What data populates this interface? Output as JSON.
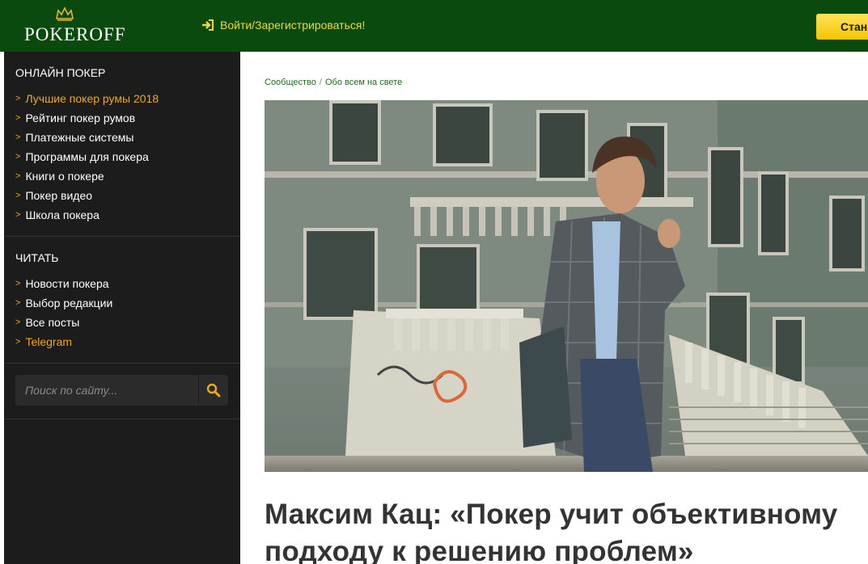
{
  "header": {
    "logo_text": "POKEROFF",
    "login_label": "Войти/Зарегистрироваться!",
    "start_button_label": "Стан",
    "colors": {
      "background": "#0b4a0f",
      "login_text": "#e8d84a",
      "button": "#f5c400"
    }
  },
  "sidebar": {
    "sections": [
      {
        "title": "ОНЛАЙН ПОКЕР",
        "items": [
          {
            "label": "Лучшие покер румы 2018",
            "highlight": true
          },
          {
            "label": "Рейтинг покер румов",
            "highlight": false
          },
          {
            "label": "Платежные системы",
            "highlight": false
          },
          {
            "label": "Программы для покера",
            "highlight": false
          },
          {
            "label": "Книги о покере",
            "highlight": false
          },
          {
            "label": "Покер видео",
            "highlight": false
          },
          {
            "label": "Школа покера",
            "highlight": false
          }
        ]
      },
      {
        "title": "ЧИТАТЬ",
        "items": [
          {
            "label": "Новости покера",
            "highlight": false
          },
          {
            "label": "Выбор редакции",
            "highlight": false
          },
          {
            "label": "Все посты",
            "highlight": false
          },
          {
            "label": "Telegram",
            "highlight": true
          }
        ]
      }
    ],
    "bullet": ">",
    "search": {
      "placeholder": "Поиск по сайту...",
      "icon": "search-icon"
    },
    "colors": {
      "background": "#1c1c1c",
      "accent": "#f0a820"
    }
  },
  "main": {
    "breadcrumb": [
      "Сообщество",
      "Обо всем на свете"
    ],
    "breadcrumb_separator": "/",
    "hero_image": "man-in-plaid-coat-in-front-of-old-building",
    "title": "Максим Кац: «Покер учит объективному подходу к решению проблем»"
  }
}
